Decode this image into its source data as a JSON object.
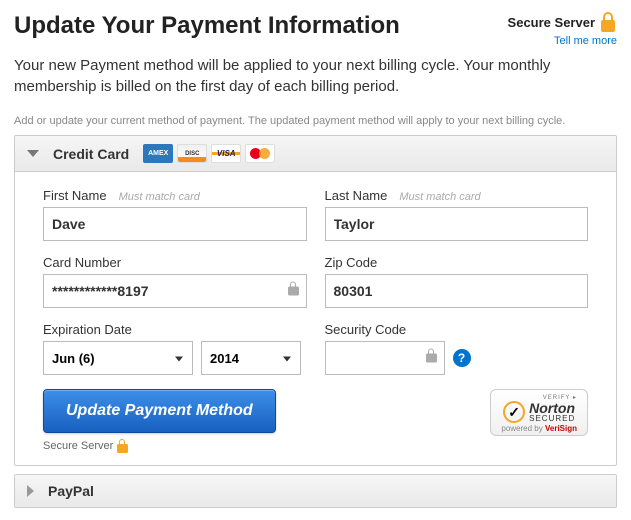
{
  "header": {
    "title": "Update Your Payment Information",
    "secure_label": "Secure Server",
    "tell_me_more": "Tell me more"
  },
  "intro": "Your new Payment method will be applied to your next billing cycle. Your monthly membership is billed on the first day of each billing period.",
  "helper": "Add or update your current method of payment. The updated payment method will apply to your next billing cycle.",
  "cc": {
    "title": "Credit Card",
    "cards": [
      "amex",
      "discover",
      "visa",
      "mastercard"
    ],
    "first_name_label": "First Name",
    "last_name_label": "Last Name",
    "match_hint": "Must match card",
    "first_name": "Dave",
    "last_name": "Taylor",
    "card_number_label": "Card Number",
    "card_number": "************8197",
    "zip_label": "Zip Code",
    "zip": "80301",
    "exp_label": "Expiration Date",
    "exp_month": "Jun (6)",
    "exp_year": "2014",
    "security_label": "Security Code",
    "security_code": "",
    "submit": "Update Payment Method",
    "secure_small": "Secure Server"
  },
  "norton": {
    "verify": "VERIFY ▸",
    "name": "Norton",
    "secured": "SECURED",
    "powered": "powered by",
    "verisign": "VeriSign"
  },
  "paypal": {
    "title": "PayPal"
  }
}
